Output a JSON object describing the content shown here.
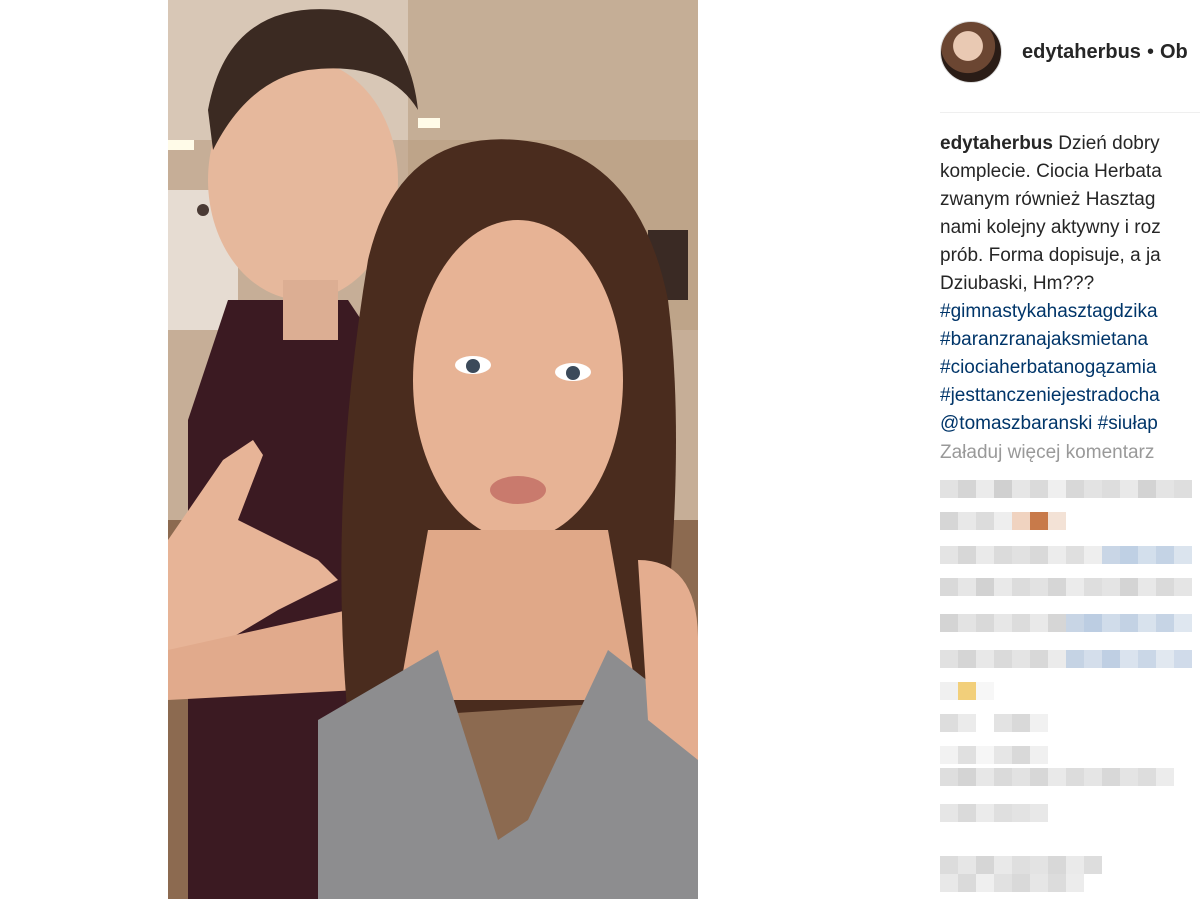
{
  "post": {
    "username": "edytaherbus",
    "separator": "•",
    "follow_label": "Ob"
  },
  "caption": {
    "username": "edytaherbus",
    "lines": [
      "Dzień dobry",
      "komplecie. Ciocia Herbata",
      "zwanym również Hasztag",
      "nami kolejny aktywny i roz",
      "prób. Forma dopisuje, a ja",
      "Dziubaski, Hm???"
    ],
    "hashtags": [
      "#gimnastykahasztagdzika",
      "#baranzranajaksmietana",
      "#ciociaherbatanogązamia",
      "#jesttanczeniejestradocha"
    ],
    "mention": "@tomaszbaranski",
    "last_tag": "#siułap"
  },
  "comments": {
    "load_more": "Załaduj więcej komentarz"
  },
  "colors": {
    "link": "#003569",
    "muted": "#999999",
    "text": "#262626"
  },
  "icons": {
    "avatar": "profile-avatar"
  }
}
